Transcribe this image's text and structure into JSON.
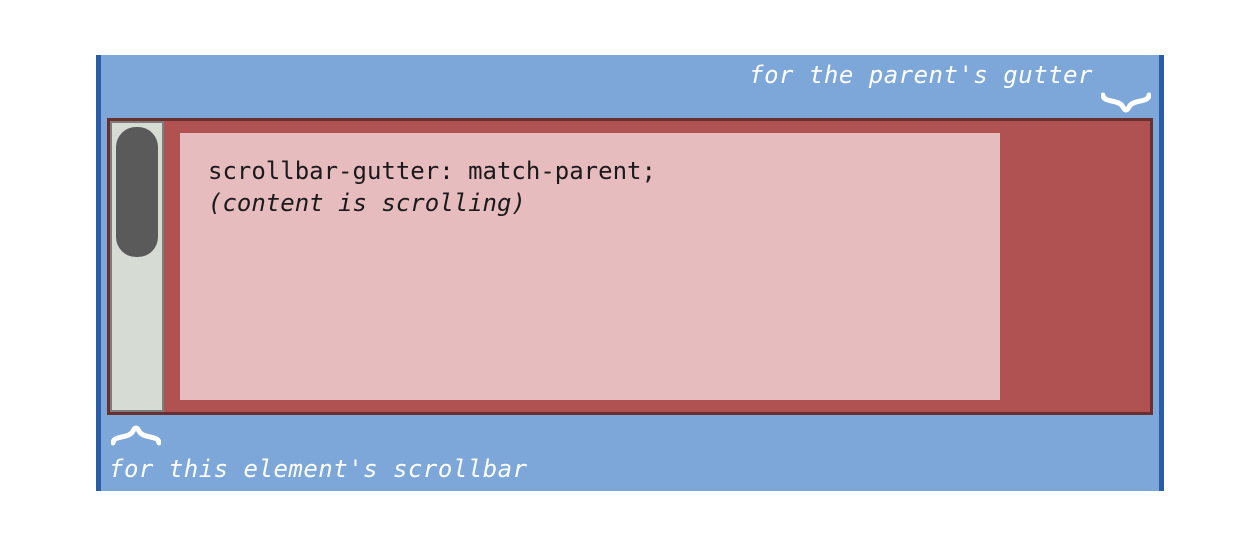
{
  "labels": {
    "top": "for the parent's gutter",
    "bottom": "for this element's scrollbar"
  },
  "content": {
    "line1": "scrollbar-gutter: match-parent;",
    "line2": "(content is scrolling)"
  },
  "colors": {
    "parent_bg": "#7ca7d8",
    "parent_border": "#2a5ca8",
    "child_bg": "#b05252",
    "child_border": "#6a2f2f",
    "inner_bg": "#e7bcbf",
    "track_bg": "#d6dbd4",
    "thumb_bg": "#5a5a5a",
    "label_text": "#ffffff"
  }
}
